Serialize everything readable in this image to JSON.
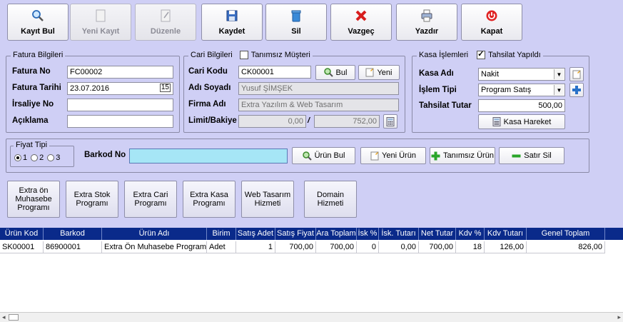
{
  "toolbar": {
    "search": "Kayıt Bul",
    "new": "Yeni Kayıt",
    "edit": "Düzenle",
    "save": "Kaydet",
    "delete": "Sil",
    "cancel": "Vazgeç",
    "print": "Yazdır",
    "close": "Kapat"
  },
  "invoice": {
    "legend": "Fatura Bilgileri",
    "no_label": "Fatura No",
    "no_value": "FC00002",
    "date_label": "Fatura Tarihi",
    "date_value": "23.07.2016",
    "waybill_label": "İrsaliye No",
    "waybill_value": "",
    "note_label": "Açıklama",
    "note_value": ""
  },
  "customer": {
    "legend": "Cari Bilgileri",
    "undefined_label": "Tanımsız Müşteri",
    "code_label": "Cari Kodu",
    "code_value": "CK00001",
    "find_btn": "Bul",
    "new_btn": "Yeni",
    "name_label": "Adı Soyadı",
    "name_value": "Yusuf ŞİMŞEK",
    "company_label": "Firma Adı",
    "company_value": "Extra Yazılım & Web Tasarım",
    "limit_label": "Limit/Bakiye",
    "limit_value": "0,00",
    "balance_value": "752,00",
    "separator": "/"
  },
  "cash": {
    "legend": "Kasa İşlemleri",
    "collect_label": "Tahsilat Yapıldı",
    "account_label": "Kasa Adı",
    "account_value": "Nakit",
    "type_label": "İşlem Tipi",
    "type_value": "Program Satış",
    "amount_label": "Tahsilat Tutar",
    "amount_value": "500,00",
    "move_btn": "Kasa Hareket"
  },
  "product": {
    "price_type_legend": "Fiyat Tipi",
    "price_types": [
      "1",
      "2",
      "3"
    ],
    "barcode_label": "Barkod No",
    "barcode_value": "",
    "find_btn": "Ürün Bul",
    "new_btn": "Yeni Ürün",
    "undefined_btn": "Tanımsız Ürün",
    "delete_btn": "Satır Sil"
  },
  "programs": [
    "Extra ön Muhasebe Programı",
    "Extra Stok Programı",
    "Extra Cari Programı",
    "Extra Kasa Programı",
    "Web Tasarım Hizmeti",
    "Domain Hizmeti"
  ],
  "grid": {
    "columns": [
      "Ürün Kod",
      "Barkod",
      "Ürün Adı",
      "Birim",
      "Satış Adet",
      "Satış Fiyat",
      "Ara Toplam",
      "İsk %",
      "İsk. Tutarı",
      "Net Tutar",
      "Kdv %",
      "Kdv Tutarı",
      "Genel Toplam"
    ],
    "rows": [
      [
        "SK00001",
        "86900001",
        "Extra Ön Muhasebe Programı",
        "Adet",
        "1",
        "700,00",
        "700,00",
        "0",
        "0,00",
        "700,00",
        "18",
        "126,00",
        "826,00"
      ]
    ]
  }
}
